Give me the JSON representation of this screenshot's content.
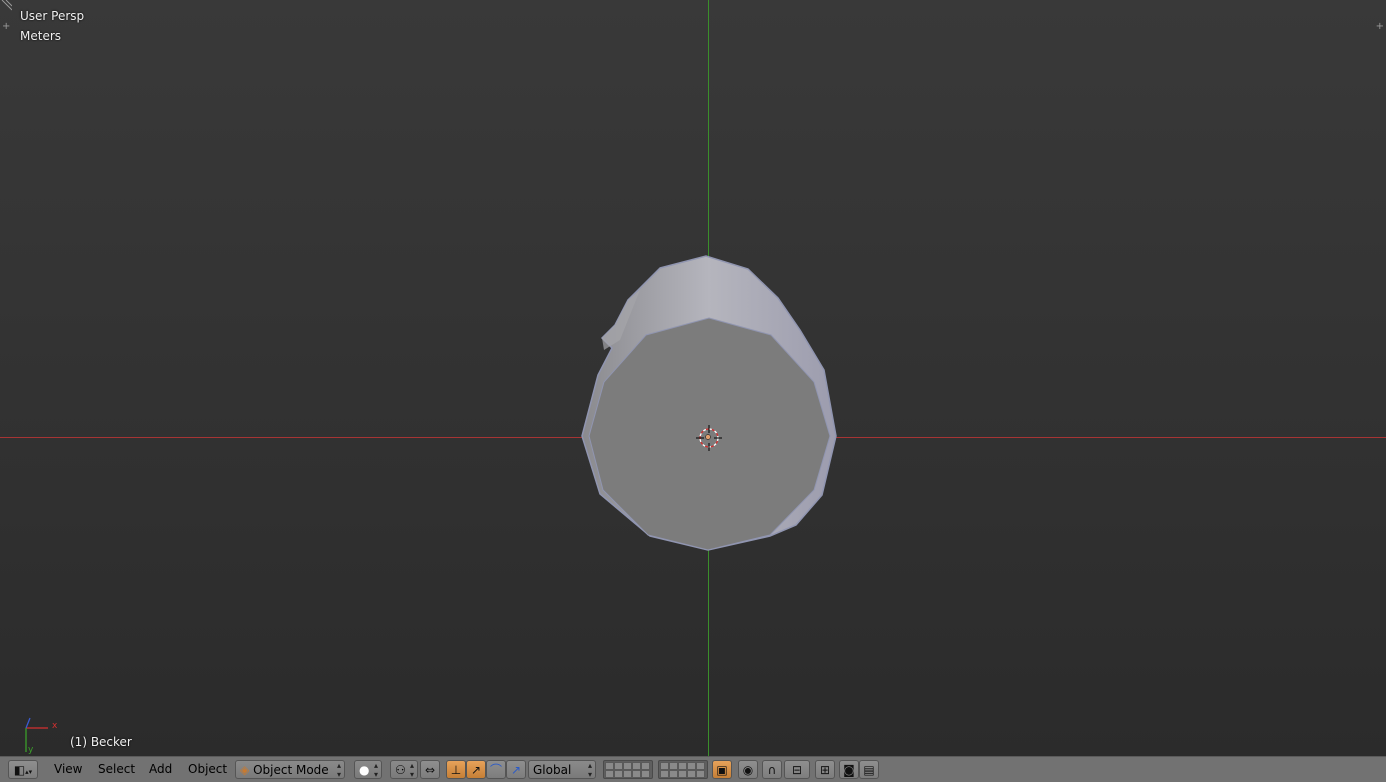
{
  "viewport": {
    "view_name": "User Persp",
    "units": "Meters",
    "active_object": "(1) Becker",
    "gizmo": {
      "x_label": "x",
      "y_label": "y"
    }
  },
  "header": {
    "editor_type_icon": "3d-view-icon",
    "menus": [
      "View",
      "Select",
      "Add",
      "Object"
    ],
    "mode": "Object Mode",
    "shading_icon": "solid-shading-icon",
    "pivot_icon": "pivot-point-icon",
    "manipulator_icons": [
      "manipulator-toggle-icon",
      "translate-icon",
      "rotate-icon",
      "scale-icon"
    ],
    "orientation": "Global",
    "snap_icons": [
      "lock-camera-icon",
      "proportional-edit-icon",
      "magnet-icon",
      "snap-element-icon",
      "snap-target-icon",
      "render-icon",
      "clapper-icon"
    ]
  },
  "colors": {
    "x_axis": "#a63434",
    "y_axis": "#3b8e2b",
    "header_bg": "#727272",
    "active_button": "#d98f47"
  }
}
